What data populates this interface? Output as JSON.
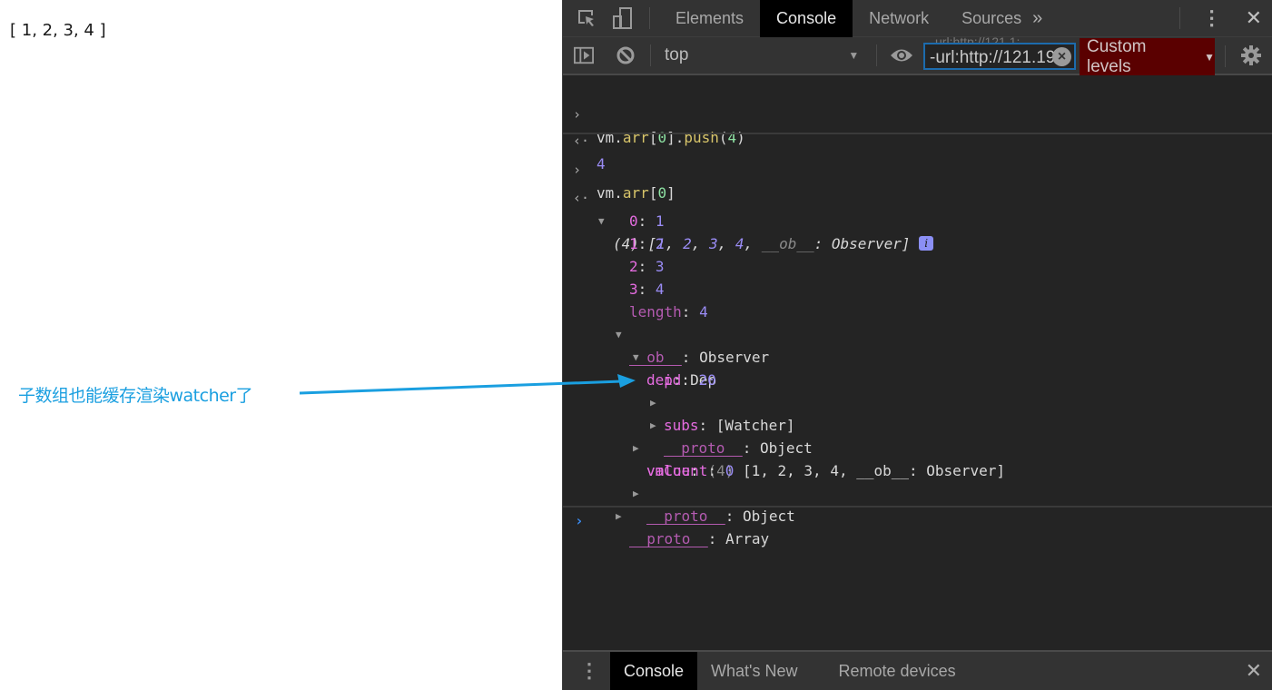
{
  "page": {
    "array_text": "[ 1, 2, 3, 4 ]",
    "annotation": "子数组也能缓存渲染watcher了",
    "annotation_color": "#1a9fe0"
  },
  "devtools": {
    "tabs": [
      {
        "label": "Elements",
        "active": false
      },
      {
        "label": "Console",
        "active": true
      },
      {
        "label": "Network",
        "active": false
      },
      {
        "label": "Sources",
        "active": false
      }
    ],
    "more_tabs_icon": "chevron-double-right-icon",
    "toolbar": {
      "context": "top",
      "filter_value": "-url:http://121.19",
      "filter_ghost": "url:http://121.1:",
      "levels_label": "Custom levels",
      "levels_color": "#5a0000"
    },
    "console": {
      "cmd1": {
        "obj": "vm",
        "prop": "arr",
        "idx": "0",
        "method": "push",
        "arg": "4"
      },
      "result1": "4",
      "cmd2": {
        "obj": "vm",
        "prop": "arr",
        "idx": "0"
      },
      "result2": {
        "count": "(4)",
        "preview_items": [
          "1",
          "2",
          "3",
          "4"
        ],
        "preview_key": "__ob__",
        "preview_type": "Observer",
        "entries": [
          {
            "key": "0",
            "value": "1"
          },
          {
            "key": "1",
            "value": "2"
          },
          {
            "key": "2",
            "value": "3"
          },
          {
            "key": "3",
            "value": "4"
          }
        ],
        "length_key": "length",
        "length_value": "4",
        "ob": {
          "key": "__ob__",
          "type": "Observer",
          "dep_key": "dep",
          "dep_type": "Dep",
          "id_key": "id",
          "id_value": "20",
          "subs_key": "subs",
          "subs_value": "[Watcher]",
          "proto_key": "__proto__",
          "proto_type": "Object",
          "value_key": "value",
          "value_count": "(4)",
          "value_preview": "[1, 2, 3, 4, __ob__: Observer]",
          "vmcount_key": "vmCount",
          "vmcount_value": "0",
          "ob_proto_type": "Object"
        },
        "array_proto_key": "__proto__",
        "array_proto_type": "Array"
      }
    },
    "drawer": {
      "tabs": [
        {
          "label": "Console",
          "active": true
        },
        {
          "label": "What's New",
          "active": false
        },
        {
          "label": "Remote devices",
          "active": false
        }
      ]
    }
  }
}
